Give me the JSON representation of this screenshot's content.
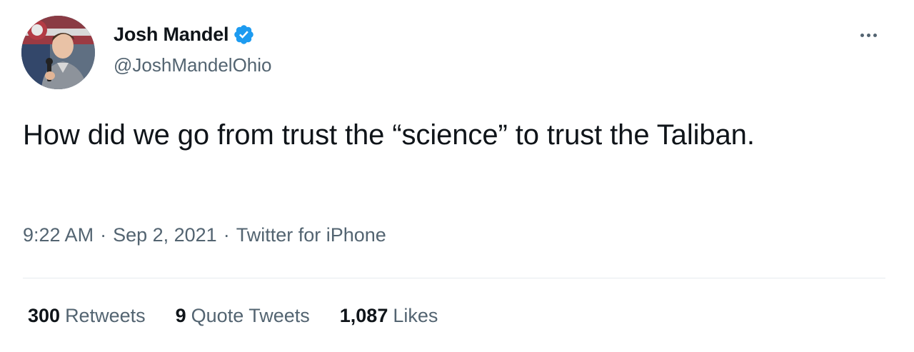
{
  "author": {
    "display_name": "Josh Mandel",
    "handle": "@JoshMandelOhio",
    "verified": true,
    "verified_color": "#1d9bf0"
  },
  "tweet": {
    "text": "How did we go from trust the “science” to trust the Taliban."
  },
  "meta": {
    "time": "9:22 AM",
    "date": "Sep 2, 2021",
    "source": "Twitter for iPhone",
    "separator": "·"
  },
  "stats": {
    "retweets_count": "300",
    "retweets_label": "Retweets",
    "quotes_count": "9",
    "quotes_label": "Quote Tweets",
    "likes_count": "1,087",
    "likes_label": "Likes"
  },
  "icons": {
    "more": "more-options-icon",
    "verified": "verified-badge-icon"
  }
}
